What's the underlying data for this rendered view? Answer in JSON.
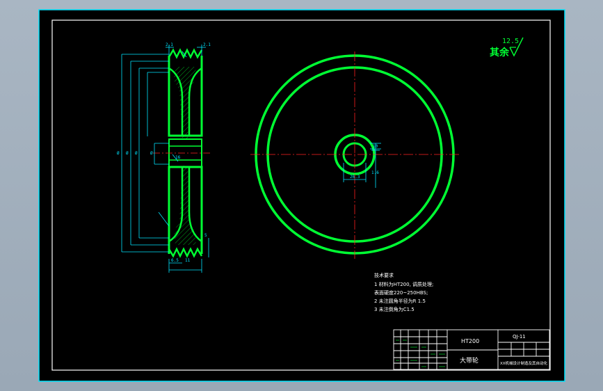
{
  "colors": {
    "background": "#000000",
    "window_frame": "#a6b3c1",
    "border_cyan": "#00e5ff",
    "outline_green": "#00ff33",
    "dimension_cyan": "#00e5ff",
    "centerline_red": "#ff2020",
    "hatch_green": "#00cc22",
    "text_white": "#ffffff"
  },
  "surface_finish": {
    "value": "12.5",
    "label": "其余"
  },
  "side_view": {
    "dims": {
      "top_left": "2.1",
      "top_right": "2.1",
      "bottom_a": "6.5",
      "bottom_b": "11",
      "diam_a": "Ø",
      "diam_b": "Ø",
      "diam_c": "Ø",
      "hub": "Ø",
      "web": "16",
      "right_side": "5"
    }
  },
  "front_view": {
    "dims": {
      "keyway_width": "10",
      "bore": "26.3",
      "keyway_depth": "1.6"
    }
  },
  "tech_requirements": {
    "title": "技术要求",
    "lines": [
      "1 材料为HT200, 调质处理;",
      "  表面硬度220~250HBS;",
      "2 未注圆角半径为R 1.5",
      "3 未注倒角为C1.5"
    ]
  },
  "title_block": {
    "material": "HT200",
    "part_name": "大带轮",
    "drawing_number": "QJ-11",
    "school": "XX机械设计制造及其自动化"
  }
}
